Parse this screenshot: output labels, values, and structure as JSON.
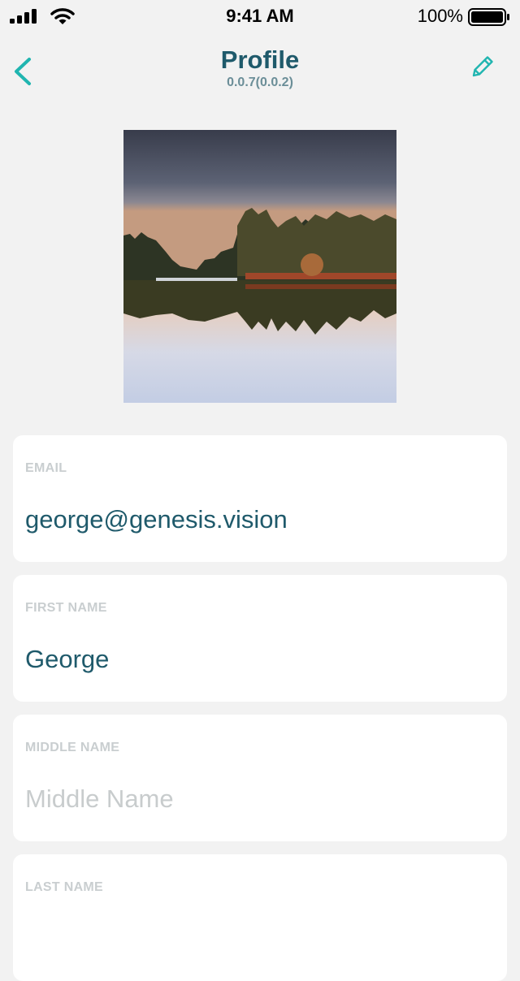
{
  "status_bar": {
    "time": "9:41 AM",
    "battery": "100%",
    "icons": [
      "signal-icon",
      "wifi-icon",
      "battery-icon"
    ]
  },
  "header": {
    "title": "Profile",
    "version": "0.0.7(0.0.2)",
    "back_icon": "chevron-left-icon",
    "edit_icon": "pencil-icon",
    "accent_color": "#20b5b0",
    "title_color": "#1f5a6b"
  },
  "avatar": {
    "description_icon": "profile-photo"
  },
  "fields": [
    {
      "label": "EMAIL",
      "value": "george@genesis.vision",
      "placeholder": ""
    },
    {
      "label": "FIRST NAME",
      "value": "George",
      "placeholder": ""
    },
    {
      "label": "MIDDLE NAME",
      "value": "",
      "placeholder": "Middle Name"
    },
    {
      "label": "LAST NAME",
      "value": "",
      "placeholder": ""
    }
  ]
}
